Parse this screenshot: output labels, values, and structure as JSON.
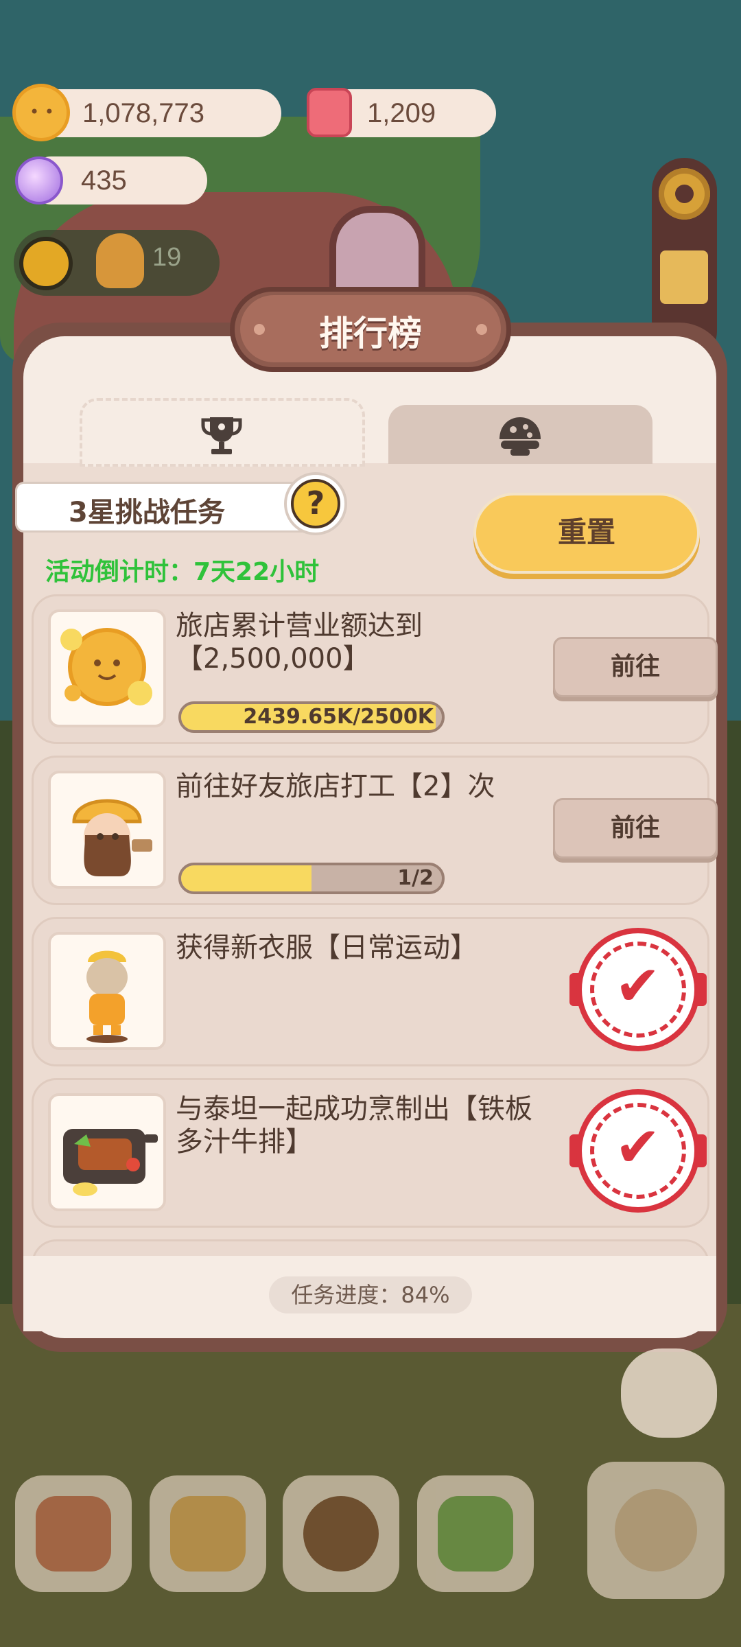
{
  "resources": {
    "coins": "1,078,773",
    "gems": "1,209",
    "candy": "435",
    "badge_count": "19"
  },
  "panel": {
    "title": "排行榜",
    "tabs": [
      {
        "icon": "trophy-icon",
        "active": true
      },
      {
        "icon": "shell-icon",
        "active": false
      }
    ],
    "challenge_label": "3星挑战任务",
    "help_label": "?",
    "countdown": "活动倒计时：7天22小时",
    "reset_label": "重置",
    "task_progress": "任务进度：84%"
  },
  "tasks": [
    {
      "text": "旅店累计营业额达到【2,500,000】",
      "progress_text": "2439.65K/2500K",
      "progress_fraction": 0.976,
      "action": "前往",
      "completed": false,
      "thumb": "coin-pile-icon"
    },
    {
      "text": "前往好友旅店打工【2】次",
      "progress_text": "1/2",
      "progress_fraction": 0.5,
      "action": "前往",
      "completed": false,
      "thumb": "worker-character-icon"
    },
    {
      "text": "获得新衣服【日常运动】",
      "completed": true,
      "thumb": "outfit-character-icon"
    },
    {
      "text": "与泰坦一起成功烹制出【铁板多汁牛排】",
      "completed": true,
      "thumb": "steak-plate-icon"
    }
  ],
  "colors": {
    "accent_yellow": "#f9c95a",
    "countdown_green": "#2fc23a",
    "stamp_red": "#d9343f",
    "panel_brown": "#7a4f45"
  }
}
